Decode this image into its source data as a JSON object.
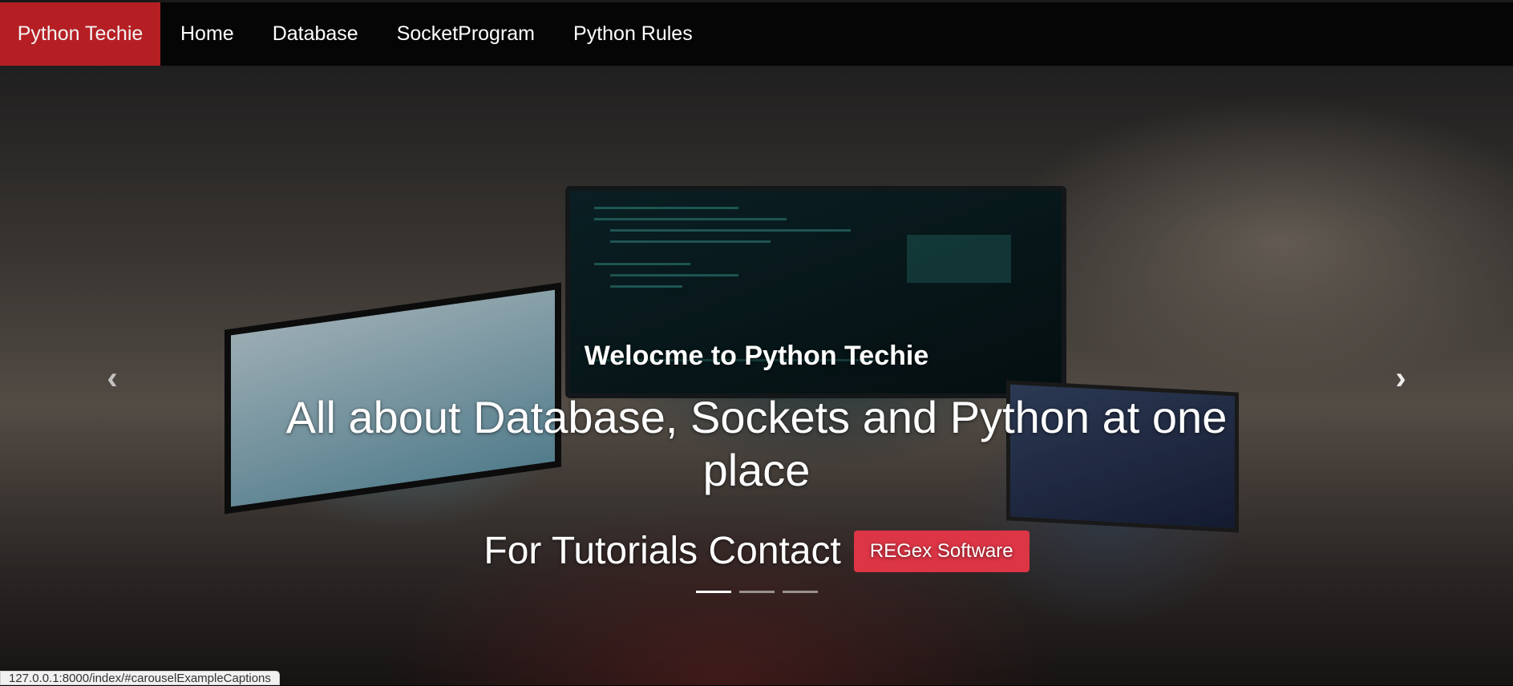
{
  "navbar": {
    "brand": "Python Techie",
    "links": [
      "Home",
      "Database",
      "SocketProgram",
      "Python Rules"
    ]
  },
  "carousel": {
    "heading": "Welocme to Python Techie",
    "main_text": "All about Database, Sockets and Python at one place",
    "contact_text": "For Tutorials Contact",
    "cta_label": "REGex Software",
    "prev_icon": "‹",
    "next_icon": "›",
    "indicator_count": 3,
    "active_indicator": 0
  },
  "status_bar": {
    "url": "127.0.0.1:8000/index/#carouselExampleCaptions"
  },
  "colors": {
    "brand_bg": "#b51f24",
    "cta_bg": "#dc3545",
    "navbar_bg": "#050505"
  }
}
